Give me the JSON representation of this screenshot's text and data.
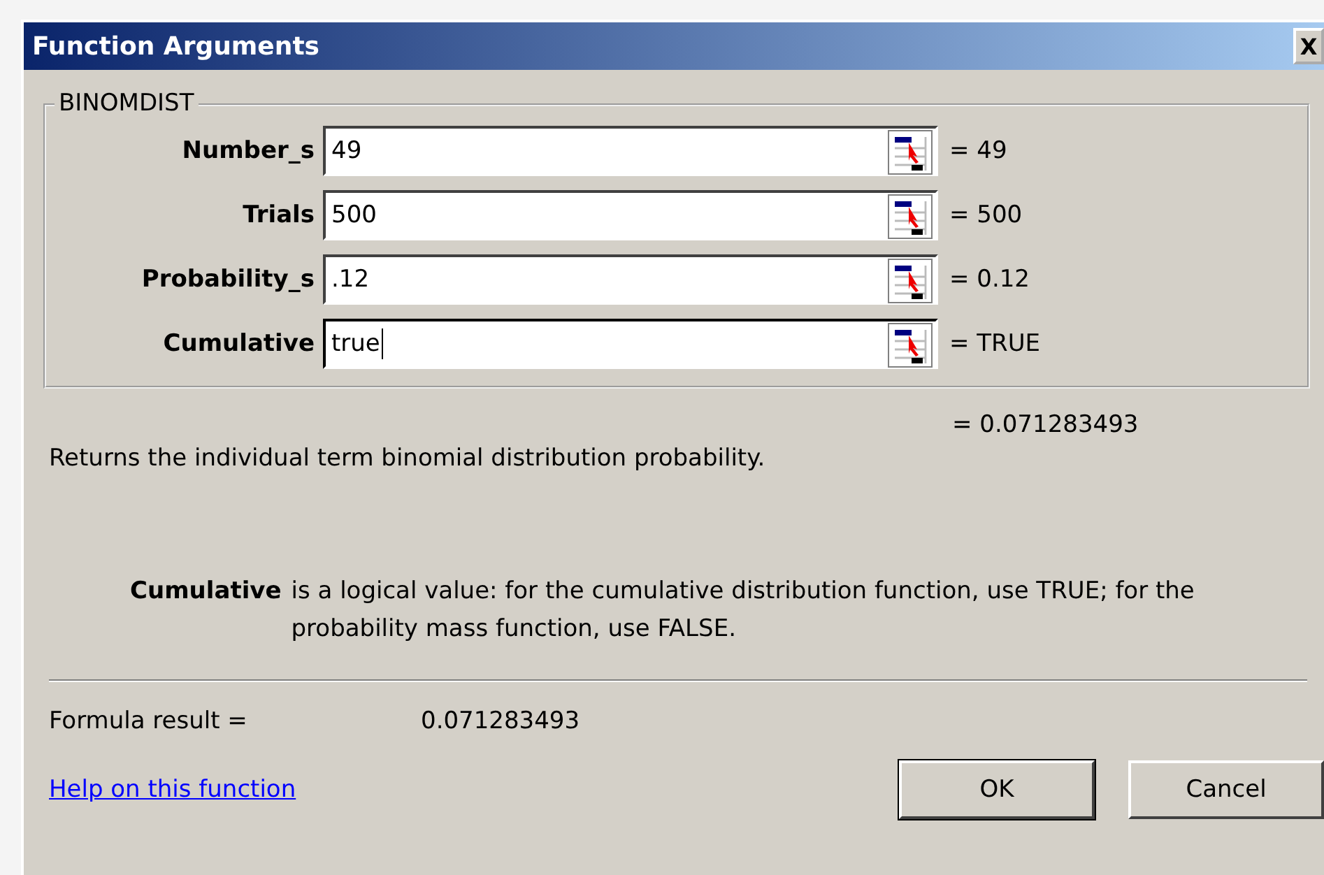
{
  "window": {
    "title": "Function Arguments",
    "close": "X"
  },
  "function_name": "BINOMDIST",
  "arguments": [
    {
      "label": "Number_s",
      "value": "49",
      "result": "= 49",
      "focused": false
    },
    {
      "label": "Trials",
      "value": "500",
      "result": "= 500",
      "focused": false
    },
    {
      "label": "Probability_s",
      "value": ".12",
      "result": "= 0.12",
      "focused": false
    },
    {
      "label": "Cumulative",
      "value": "true",
      "result": "= TRUE",
      "focused": true
    }
  ],
  "function_result": "= 0.071283493",
  "description": "Returns the individual term binomial distribution probability.",
  "argument_help": {
    "name": "Cumulative",
    "text": "is a logical value: for the cumulative distribution function, use TRUE; for the probability mass function, use FALSE."
  },
  "formula_result": {
    "label": "Formula result =",
    "value": "0.071283493"
  },
  "help_link": "Help on this function",
  "buttons": [
    {
      "label": "OK",
      "default": true
    },
    {
      "label": "Cancel",
      "default": false
    }
  ]
}
